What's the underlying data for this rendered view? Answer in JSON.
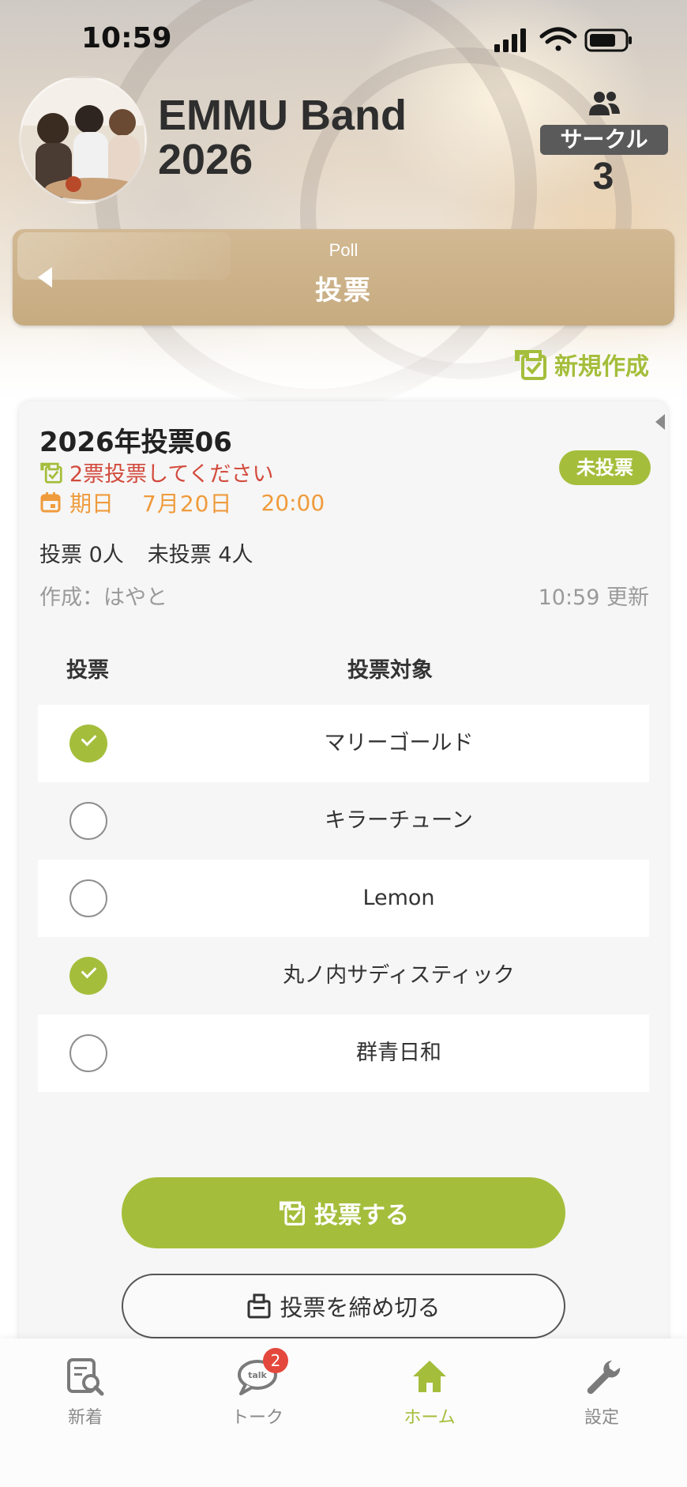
{
  "status_bar": {
    "time": "10:59",
    "icons": [
      "signal-icon",
      "wifi-icon",
      "battery-icon"
    ]
  },
  "group": {
    "name": "EMMU Band\n2026",
    "circle_label": "サークル",
    "circle_count": "3"
  },
  "banner": {
    "subtitle": "Poll",
    "title": "投票"
  },
  "new_create_label": "新規作成",
  "poll": {
    "title": "2026年投票06",
    "vote_note": "2票投票してください",
    "deadline_label": "期日",
    "deadline_date": "7月20日",
    "deadline_time": "20:00",
    "status_badge": "未投票",
    "voted_count": "投票 0人",
    "unvoted_count": "未投票 4人",
    "creator": "作成：はやと",
    "updated": "10:59 更新",
    "header_vote": "投票",
    "header_target": "投票対象",
    "options": [
      {
        "label": "マリーゴールド",
        "checked": true
      },
      {
        "label": "キラーチューン",
        "checked": false
      },
      {
        "label": "Lemon",
        "checked": false
      },
      {
        "label": "丸ノ内サディスティック",
        "checked": true
      },
      {
        "label": "群青日和",
        "checked": false
      }
    ],
    "vote_button": "投票する",
    "close_button": "投票を締め切る"
  },
  "tabs": [
    {
      "label": "新着",
      "icon": "search-document-icon"
    },
    {
      "label": "トーク",
      "icon": "talk-bubble-icon",
      "badge": "2"
    },
    {
      "label": "ホーム",
      "icon": "home-icon",
      "active": true
    },
    {
      "label": "設定",
      "icon": "wrench-icon"
    }
  ],
  "colors": {
    "accent": "#a4be3b",
    "banner": "#c9ae84",
    "alert": "#d24a3c",
    "deadline": "#ef9b3c",
    "badge": "#e4473c"
  }
}
